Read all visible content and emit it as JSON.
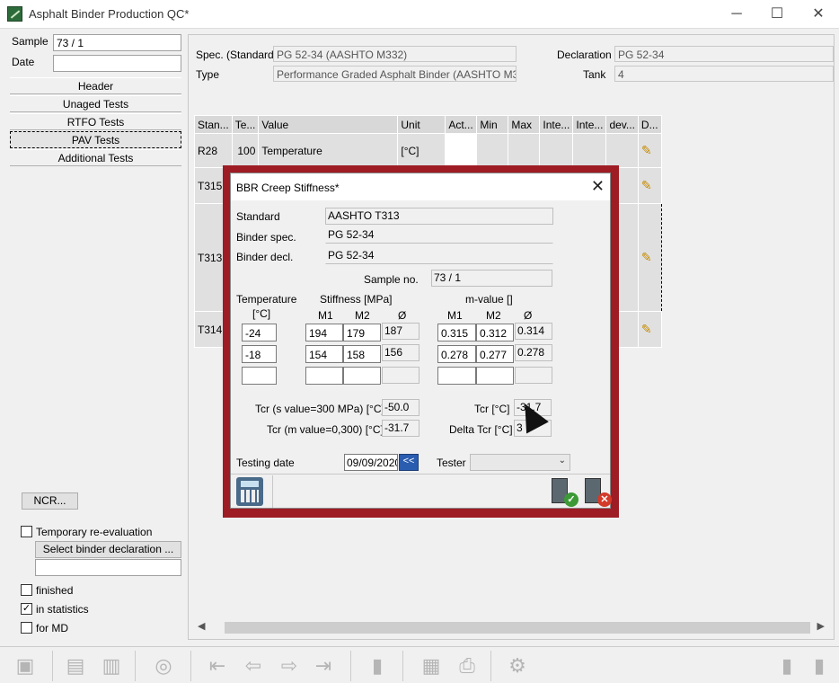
{
  "window": {
    "title": "Asphalt Binder Production QC*",
    "minimize": "─",
    "maximize": "☐",
    "close": "✕"
  },
  "left": {
    "sample_label": "Sample",
    "sample_value": "73 / 1",
    "date_label": "Date",
    "date_value": "",
    "nav": [
      "Header",
      "Unaged Tests",
      "RTFO Tests",
      "PAV Tests",
      "Additional Tests"
    ],
    "active_nav": "PAV Tests",
    "ncr_button": "NCR...",
    "temp_reeval_label": "Temporary re-evaluation",
    "select_decl_button": "Select binder declaration ...",
    "finished_label": "finished",
    "in_statistics_label": "in statistics",
    "for_md_label": "for MD",
    "in_statistics_checked": "✓"
  },
  "header": {
    "spec_label": "Spec. (Standard)",
    "spec_value": "PG 52-34 (AASHTO M332)",
    "type_label": "Type",
    "type_value": "Performance Graded Asphalt Binder (AASHTO M332)",
    "decl_label": "Declaration",
    "decl_value": "PG 52-34",
    "tank_label": "Tank",
    "tank_value": "4"
  },
  "grid": {
    "columns": [
      "Stan...",
      "Te...",
      "Value",
      "Unit",
      "Act...",
      "Min",
      "Max",
      "Inte...",
      "Inte...",
      "dev...",
      "D..."
    ],
    "rows": [
      {
        "std": "R28",
        "te": "100",
        "value": "Temperature",
        "unit": "[°C]"
      },
      {
        "std": "T315",
        "te": "",
        "value": "",
        "unit": ""
      },
      {
        "std": "T313",
        "te": "",
        "value": "",
        "unit": ""
      },
      {
        "std": "T314",
        "te": "",
        "value": "",
        "unit": ""
      }
    ]
  },
  "modal": {
    "title": "BBR Creep Stiffness*",
    "close": "✕",
    "standard_label": "Standard",
    "standard_value": "AASHTO T313",
    "binder_spec_label": "Binder spec.",
    "binder_spec_value": "PG 52-34",
    "binder_decl_label": "Binder decl.",
    "binder_decl_value": "PG 52-34",
    "sample_no_label": "Sample no.",
    "sample_no_value": "73 / 1",
    "temperature_label": "Temperature",
    "temperature_unit": "[°C]",
    "stiffness_label": "Stiffness [MPa]",
    "mvalue_label": "m-value []",
    "m1": "M1",
    "m2": "M2",
    "avg": "Ø",
    "rows": [
      {
        "temp": "-24",
        "s1": "194",
        "s2": "179",
        "savg": "187",
        "m1": "0.315",
        "m2": "0.312",
        "mavg": "0.314"
      },
      {
        "temp": "-18",
        "s1": "154",
        "s2": "158",
        "savg": "156",
        "m1": "0.278",
        "m2": "0.277",
        "mavg": "0.278"
      },
      {
        "temp": "",
        "s1": "",
        "s2": "",
        "savg": "",
        "m1": "",
        "m2": "",
        "mavg": ""
      }
    ],
    "tcr_s_label": "Tcr (s value=300 MPa) [°C]",
    "tcr_s_value": "-50.0",
    "tcr_m_label": "Tcr (m value=0,300) [°C]",
    "tcr_m_value": "-31.7",
    "tcr_label": "Tcr [°C]",
    "tcr_value": "-31.7",
    "delta_tcr_label": "Delta Tcr [°C]",
    "delta_tcr_value": "3",
    "testing_date_label": "Testing date",
    "testing_date_value": "09/09/2020",
    "date_btn": "<<",
    "tester_label": "Tester",
    "tester_value": "",
    "ok_badge": "✓",
    "cancel_badge": "✕"
  },
  "colors": {
    "modal_frame": "#9e1c24",
    "accent": "#2a5db0"
  }
}
